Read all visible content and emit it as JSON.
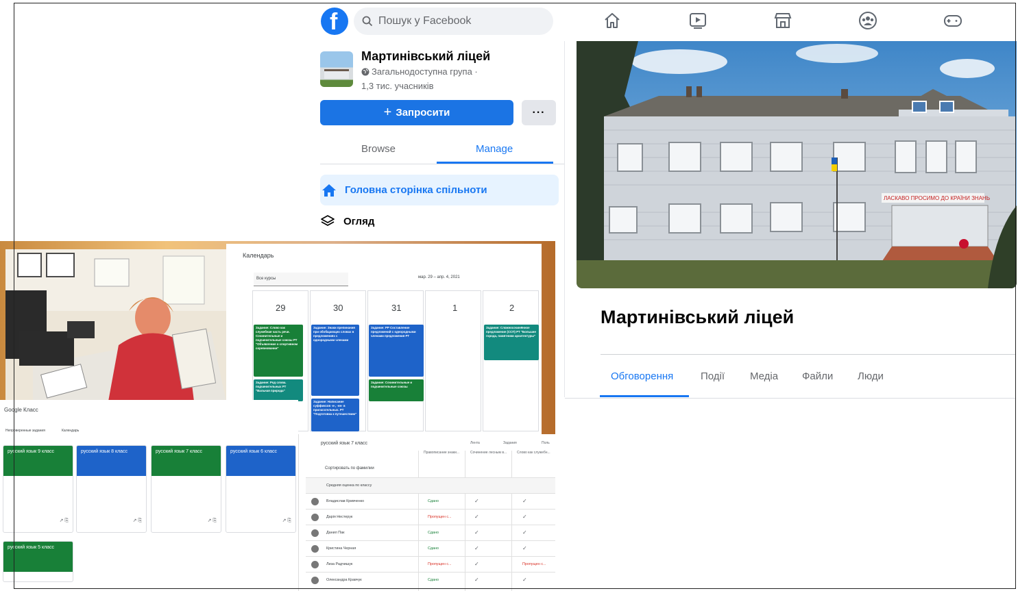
{
  "header": {
    "logo_glyph": "f",
    "search_placeholder": "Пошук у Facebook",
    "nav_icons": [
      "home-icon",
      "watch-icon",
      "marketplace-icon",
      "groups-icon",
      "gaming-icon"
    ],
    "brand_color": "#1877f2"
  },
  "group": {
    "name": "Мартинівський ліцей",
    "privacy": "Загальнодоступна група ·",
    "members": "1,3 тис. учасників",
    "invite_label": "Запросити",
    "invite_plus": "+",
    "more_label": "···"
  },
  "sidebar": {
    "tabs": [
      {
        "label": "Browse",
        "active": false
      },
      {
        "label": "Manage",
        "active": true
      }
    ],
    "home_label": "Головна сторінка спільноти",
    "overview_label": "Огляд"
  },
  "right": {
    "title": "Мартинівський ліцей",
    "tabs": [
      {
        "label": "Обговорення",
        "active": true
      },
      {
        "label": "Події",
        "active": false
      },
      {
        "label": "Медіа",
        "active": false
      },
      {
        "label": "Файли",
        "active": false
      },
      {
        "label": "Люди",
        "active": false
      }
    ],
    "banner_text": "ЛАСКАВО ПРОСИМО ДО КРАЇНИ ЗНАНЬ"
  },
  "collage": {
    "calendar": {
      "title": "Календарь",
      "select_value": "Все курсы",
      "range": "мар. 29 – апр. 4, 2021",
      "days": [
        "29",
        "30",
        "31",
        "1",
        "2"
      ],
      "cards": [
        "Задание: Слово как служебная часть речи. Сочинительные и подчинительные союзы РТ \"Объявление о спортивном соревновании\"",
        "Задание: Род слова. подчинительных РТ \"Вальная природа\"",
        "Задание: Знаки препинания при обобщающих словах в предложениях с однородными членами",
        "Задание: Написание суффиксов -н-, -нн- в прилагательных. РТ \"Подготовка к путешествию\"",
        "Задание: РР Составление предложений с однородными членами предложения РТ",
        "Задание: Сочинительные и подчинительные союзы",
        "Задание: Сложносочинённое предложение (ССП) РТ \"Большие города, памятники архитектуры\""
      ]
    },
    "classroom": {
      "logo": "Google Класс",
      "sub_links": [
        "Непроверенные задания",
        "Календарь"
      ],
      "courses": [
        {
          "name": "русский язык 9 класс",
          "color": "#188038"
        },
        {
          "name": "русский язык 8 класс",
          "color": "#1e63c9"
        },
        {
          "name": "русский язык 7 класс",
          "color": "#188038"
        },
        {
          "name": "русский язык 6 класс",
          "color": "#1e63c9"
        },
        {
          "name": "русский язык 5 класс",
          "color": "#188038"
        }
      ]
    },
    "gradebook": {
      "title": "русский язык 7 класс",
      "top_tabs": [
        "Лента",
        "Задания",
        "Поль"
      ],
      "columns": [
        "Правописание знаки...",
        "Сочинение лесным в...",
        "Слово как служебн..."
      ],
      "sort_label": "Сортировать по фамилии",
      "average_label": "Средняя оценка по классу",
      "rows": [
        {
          "name": "Владислав Кривченко",
          "status": "Сдано",
          "late": false
        },
        {
          "name": "Дарiя Нестерук",
          "status": "Пропущен с...",
          "late": true
        },
        {
          "name": "Данил Пак",
          "status": "Сдано",
          "late": false
        },
        {
          "name": "Кристина Черная",
          "status": "Сдано",
          "late": false
        },
        {
          "name": "Лиза Радчишук",
          "status": "Пропущен с...",
          "late": true
        },
        {
          "name": "Олександра Кравчук",
          "status": "Сдано",
          "late": false
        }
      ]
    }
  }
}
